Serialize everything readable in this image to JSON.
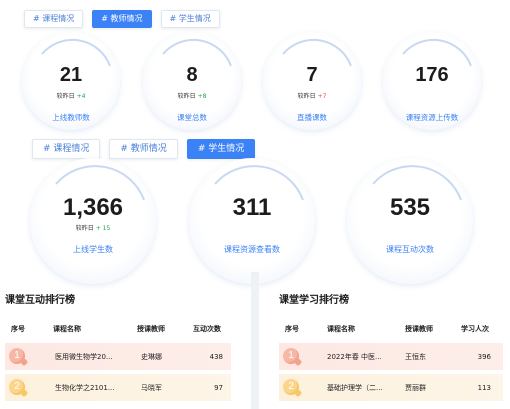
{
  "top_tabs": [
    {
      "label": "# 课程情况",
      "active": false
    },
    {
      "label": "# 教师情况",
      "active": true
    },
    {
      "label": "# 学生情况",
      "active": false
    }
  ],
  "teacher_stats": [
    {
      "value": "21",
      "compare_label": "较昨日",
      "delta": "+4",
      "trend": "up",
      "label": "上线教师数"
    },
    {
      "value": "8",
      "compare_label": "较昨日",
      "delta": "+8",
      "trend": "up",
      "label": "课堂总数"
    },
    {
      "value": "7",
      "compare_label": "较昨日",
      "delta": "+7",
      "trend": "down",
      "label": "直播课数"
    },
    {
      "value": "176",
      "compare_label": "",
      "delta": "",
      "trend": "",
      "label": "课程资源上传数"
    }
  ],
  "mid_tabs": [
    {
      "label": "# 课程情况",
      "active": false
    },
    {
      "label": "# 教师情况",
      "active": false
    },
    {
      "label": "# 学生情况",
      "active": true
    }
  ],
  "student_stats": [
    {
      "value": "1,366",
      "compare_label": "较昨日",
      "delta": "+ 15",
      "trend": "up",
      "label": "上线学生数"
    },
    {
      "value": "311",
      "compare_label": "",
      "delta": "",
      "trend": "",
      "label": "课程资源查看数"
    },
    {
      "value": "535",
      "compare_label": "",
      "delta": "",
      "trend": "",
      "label": "课程互动次数"
    }
  ],
  "interaction_rank": {
    "title": "课堂互动排行榜",
    "headers": [
      "序号",
      "课程名称",
      "授课教师",
      "互动次数"
    ],
    "rows": [
      {
        "rank": "1",
        "course": "医用微生物学20...",
        "teacher": "史琳娜",
        "count": "438"
      },
      {
        "rank": "2",
        "course": "生物化学之2101...",
        "teacher": "马晓军",
        "count": "97"
      }
    ]
  },
  "learning_rank": {
    "title": "课堂学习排行榜",
    "headers": [
      "序号",
      "课程名称",
      "授课教师",
      "学习人次"
    ],
    "rows": [
      {
        "rank": "1",
        "course": "2022年春 中医...",
        "teacher": "王恒东",
        "count": "396"
      },
      {
        "rank": "2",
        "course": "基础护理学（二...",
        "teacher": "贾丽群",
        "count": "113"
      }
    ]
  },
  "colors": {
    "accent": "#3b82f6",
    "up": "#22a34a",
    "down": "#e0554b",
    "rank1_bg": "#fde8e3",
    "rank2_bg": "#fdf1dd"
  }
}
